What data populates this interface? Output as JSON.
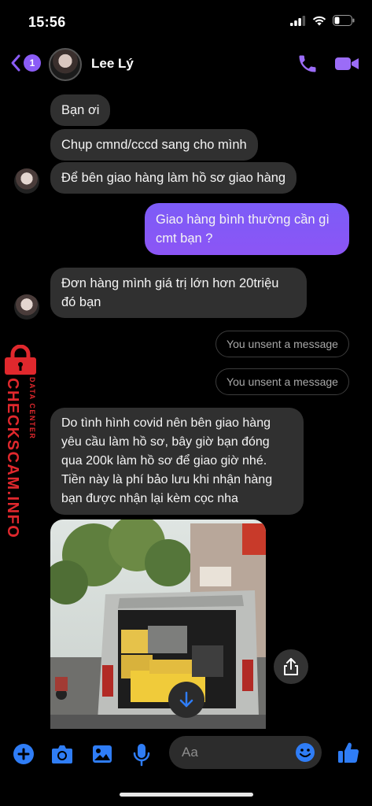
{
  "status": {
    "time": "15:56"
  },
  "header": {
    "back_count": "1",
    "contact_name": "Lee Lý"
  },
  "messages": [
    {
      "text": "Bạn ơi"
    },
    {
      "text": "Chụp cmnd/cccd sang cho mình"
    },
    {
      "text": "Để bên giao hàng làm hồ sơ giao hàng"
    },
    {
      "text": "Giao hàng bình thường cần gì cmt bạn ?"
    },
    {
      "text": "Đơn hàng mình giá trị lớn  hơn 20triệu đó bạn"
    },
    {
      "text": "You unsent a message"
    },
    {
      "text": "You unsent a message"
    },
    {
      "text": "Do tình hình covid nên bên giao hàng yêu cầu làm hồ sơ, bây giờ bạn đóng qua 200k làm hồ sơ  để giao giờ nhé. Tiền này là phí bảo lưu khi nhận hàng bạn được nhận lại kèm cọc nha"
    }
  ],
  "watermark": {
    "brand": "CHECKSCAM.INFO",
    "tag": "DATA CENTER"
  },
  "composer": {
    "placeholder": "Aa"
  },
  "colors": {
    "accent": "#8b5cf6",
    "bubble_in": "#303030",
    "watermark": "#e0282d",
    "composer_icons": "#2f7df6"
  }
}
